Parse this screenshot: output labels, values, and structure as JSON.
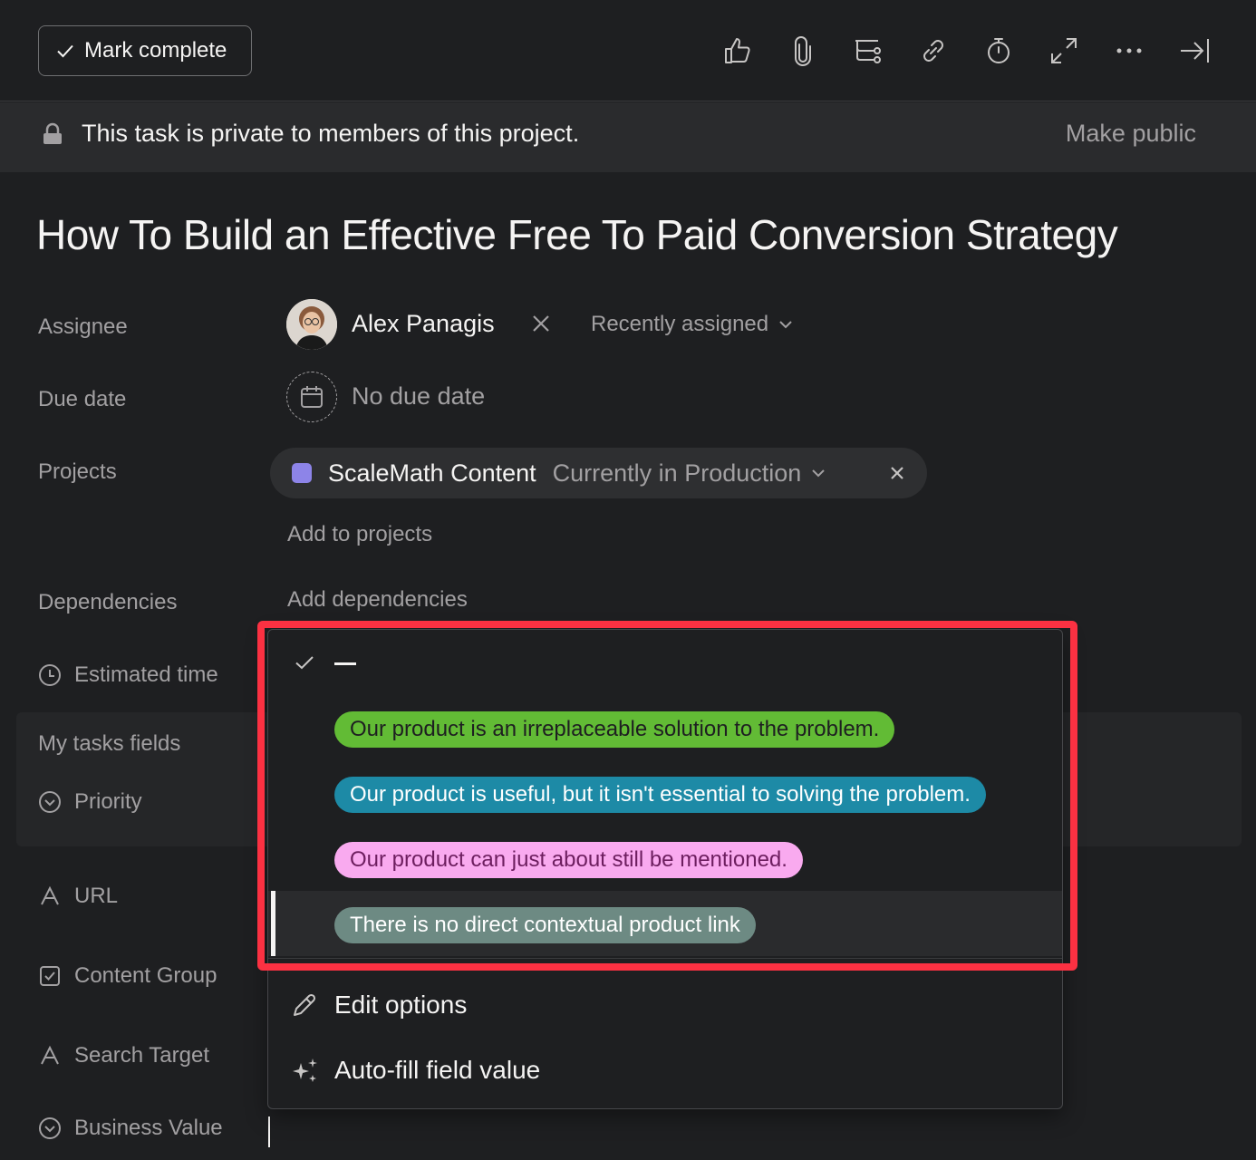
{
  "toolbar": {
    "mark_complete": "Mark complete",
    "icons": [
      "thumbs-up-icon",
      "paperclip-icon",
      "subtask-icon",
      "link-icon",
      "timer-icon",
      "expand-icon",
      "more-icon",
      "close-panel-icon"
    ]
  },
  "privacy": {
    "message": "This task is private to members of this project.",
    "make_public": "Make public"
  },
  "task": {
    "title": "How To Build an Effective Free To Paid Conversion Strategy"
  },
  "fields": {
    "assignee_label": "Assignee",
    "assignee_name": "Alex Panagis",
    "recently_assigned": "Recently assigned",
    "due_date_label": "Due date",
    "due_date_value": "No due date",
    "projects_label": "Projects",
    "project_name": "ScaleMath Content",
    "project_section": "Currently in Production",
    "project_color": "#8d84e8",
    "add_to_projects": "Add to projects",
    "dependencies_label": "Dependencies",
    "add_dependencies": "Add dependencies",
    "estimated_time_label": "Estimated time",
    "my_tasks_fields_label": "My tasks fields",
    "priority_label": "Priority",
    "url_label": "URL",
    "content_group_label": "Content Group",
    "search_target_label": "Search Target",
    "business_value_label": "Business Value"
  },
  "dropdown": {
    "selected": "—",
    "options": [
      {
        "label": "Our product is an irreplaceable solution to the problem.",
        "bg": "#62bb35",
        "fg": "#1e1f21"
      },
      {
        "label": "Our product is useful, but it isn't essential to solving the problem.",
        "bg": "#1d8aa6",
        "fg": "#ffffff"
      },
      {
        "label": "Our product can just about still be mentioned.",
        "bg": "#f9aaef",
        "fg": "#6d1e5f"
      },
      {
        "label": "There is no direct contextual product link",
        "bg": "#6d8a83",
        "fg": "#ffffff"
      }
    ],
    "edit_options": "Edit options",
    "auto_fill": "Auto-fill field value"
  },
  "colors": {
    "highlight": "#fb3142",
    "background": "#1e1f21"
  }
}
